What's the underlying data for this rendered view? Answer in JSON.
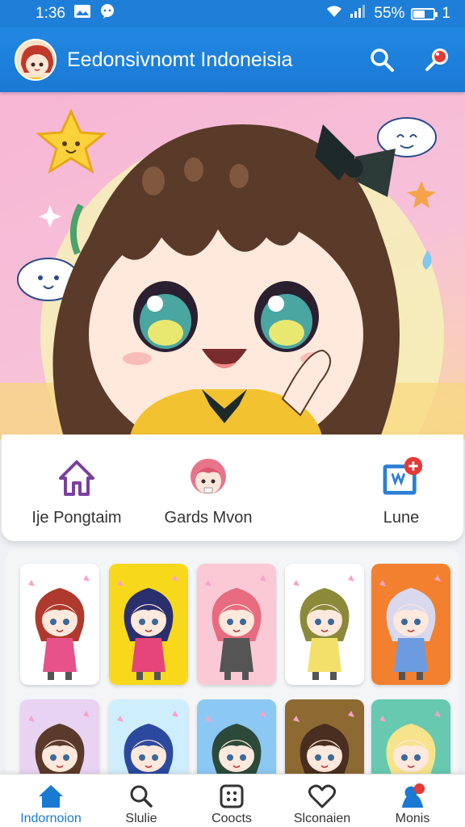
{
  "status_bar": {
    "time": "1:36",
    "battery_percent": "55%",
    "extra": "1",
    "battery_level": 0.55
  },
  "app_bar": {
    "title": "Eedonsivnomt Indoneisia"
  },
  "quick_actions": [
    {
      "label": "Ije Pongtaim",
      "icon": "house-icon"
    },
    {
      "label": "Gards Mvon",
      "icon": "character-icon"
    },
    {
      "label": "Lune",
      "icon": "add-photo-icon"
    }
  ],
  "tiles": [
    {
      "bg": "#ffffff",
      "hair": "#b0392d",
      "outfit": "#e8528a"
    },
    {
      "bg": "#f8d81a",
      "hair": "#2a2f6e",
      "outfit": "#e5457a"
    },
    {
      "bg": "#fbc9d6",
      "hair": "#e86b80",
      "outfit": "#555555"
    },
    {
      "bg": "#ffffff",
      "hair": "#8a8a3a",
      "outfit": "#f3e06a"
    },
    {
      "bg": "#f2802e",
      "hair": "#d8d8ee",
      "outfit": "#6d9be0"
    },
    {
      "bg": "#e9d3f3",
      "hair": "#5a3a2a",
      "outfit": "#ffffff"
    },
    {
      "bg": "#cfeefc",
      "hair": "#2b4a9e",
      "outfit": "#ffffff"
    },
    {
      "bg": "#8cc8f4",
      "hair": "#2c4a3a",
      "outfit": "#ffffff"
    },
    {
      "bg": "#8c6a32",
      "hair": "#4a2e1f",
      "outfit": "#ffffff"
    },
    {
      "bg": "#67c9b0",
      "hair": "#f6e38c",
      "outfit": "#ffffff"
    }
  ],
  "bottom_nav": [
    {
      "label": "Indornoion",
      "icon": "home-icon",
      "active": true
    },
    {
      "label": "Slulie",
      "icon": "search-icon",
      "active": false
    },
    {
      "label": "Coocts",
      "icon": "dice-icon",
      "active": false
    },
    {
      "label": "Slconaien",
      "icon": "heart-icon",
      "active": false
    },
    {
      "label": "Monis",
      "icon": "profile-icon",
      "active": false
    }
  ],
  "colors": {
    "primary": "#1f7fd8",
    "accent": "#e53935",
    "purple": "#7b3fa0"
  }
}
